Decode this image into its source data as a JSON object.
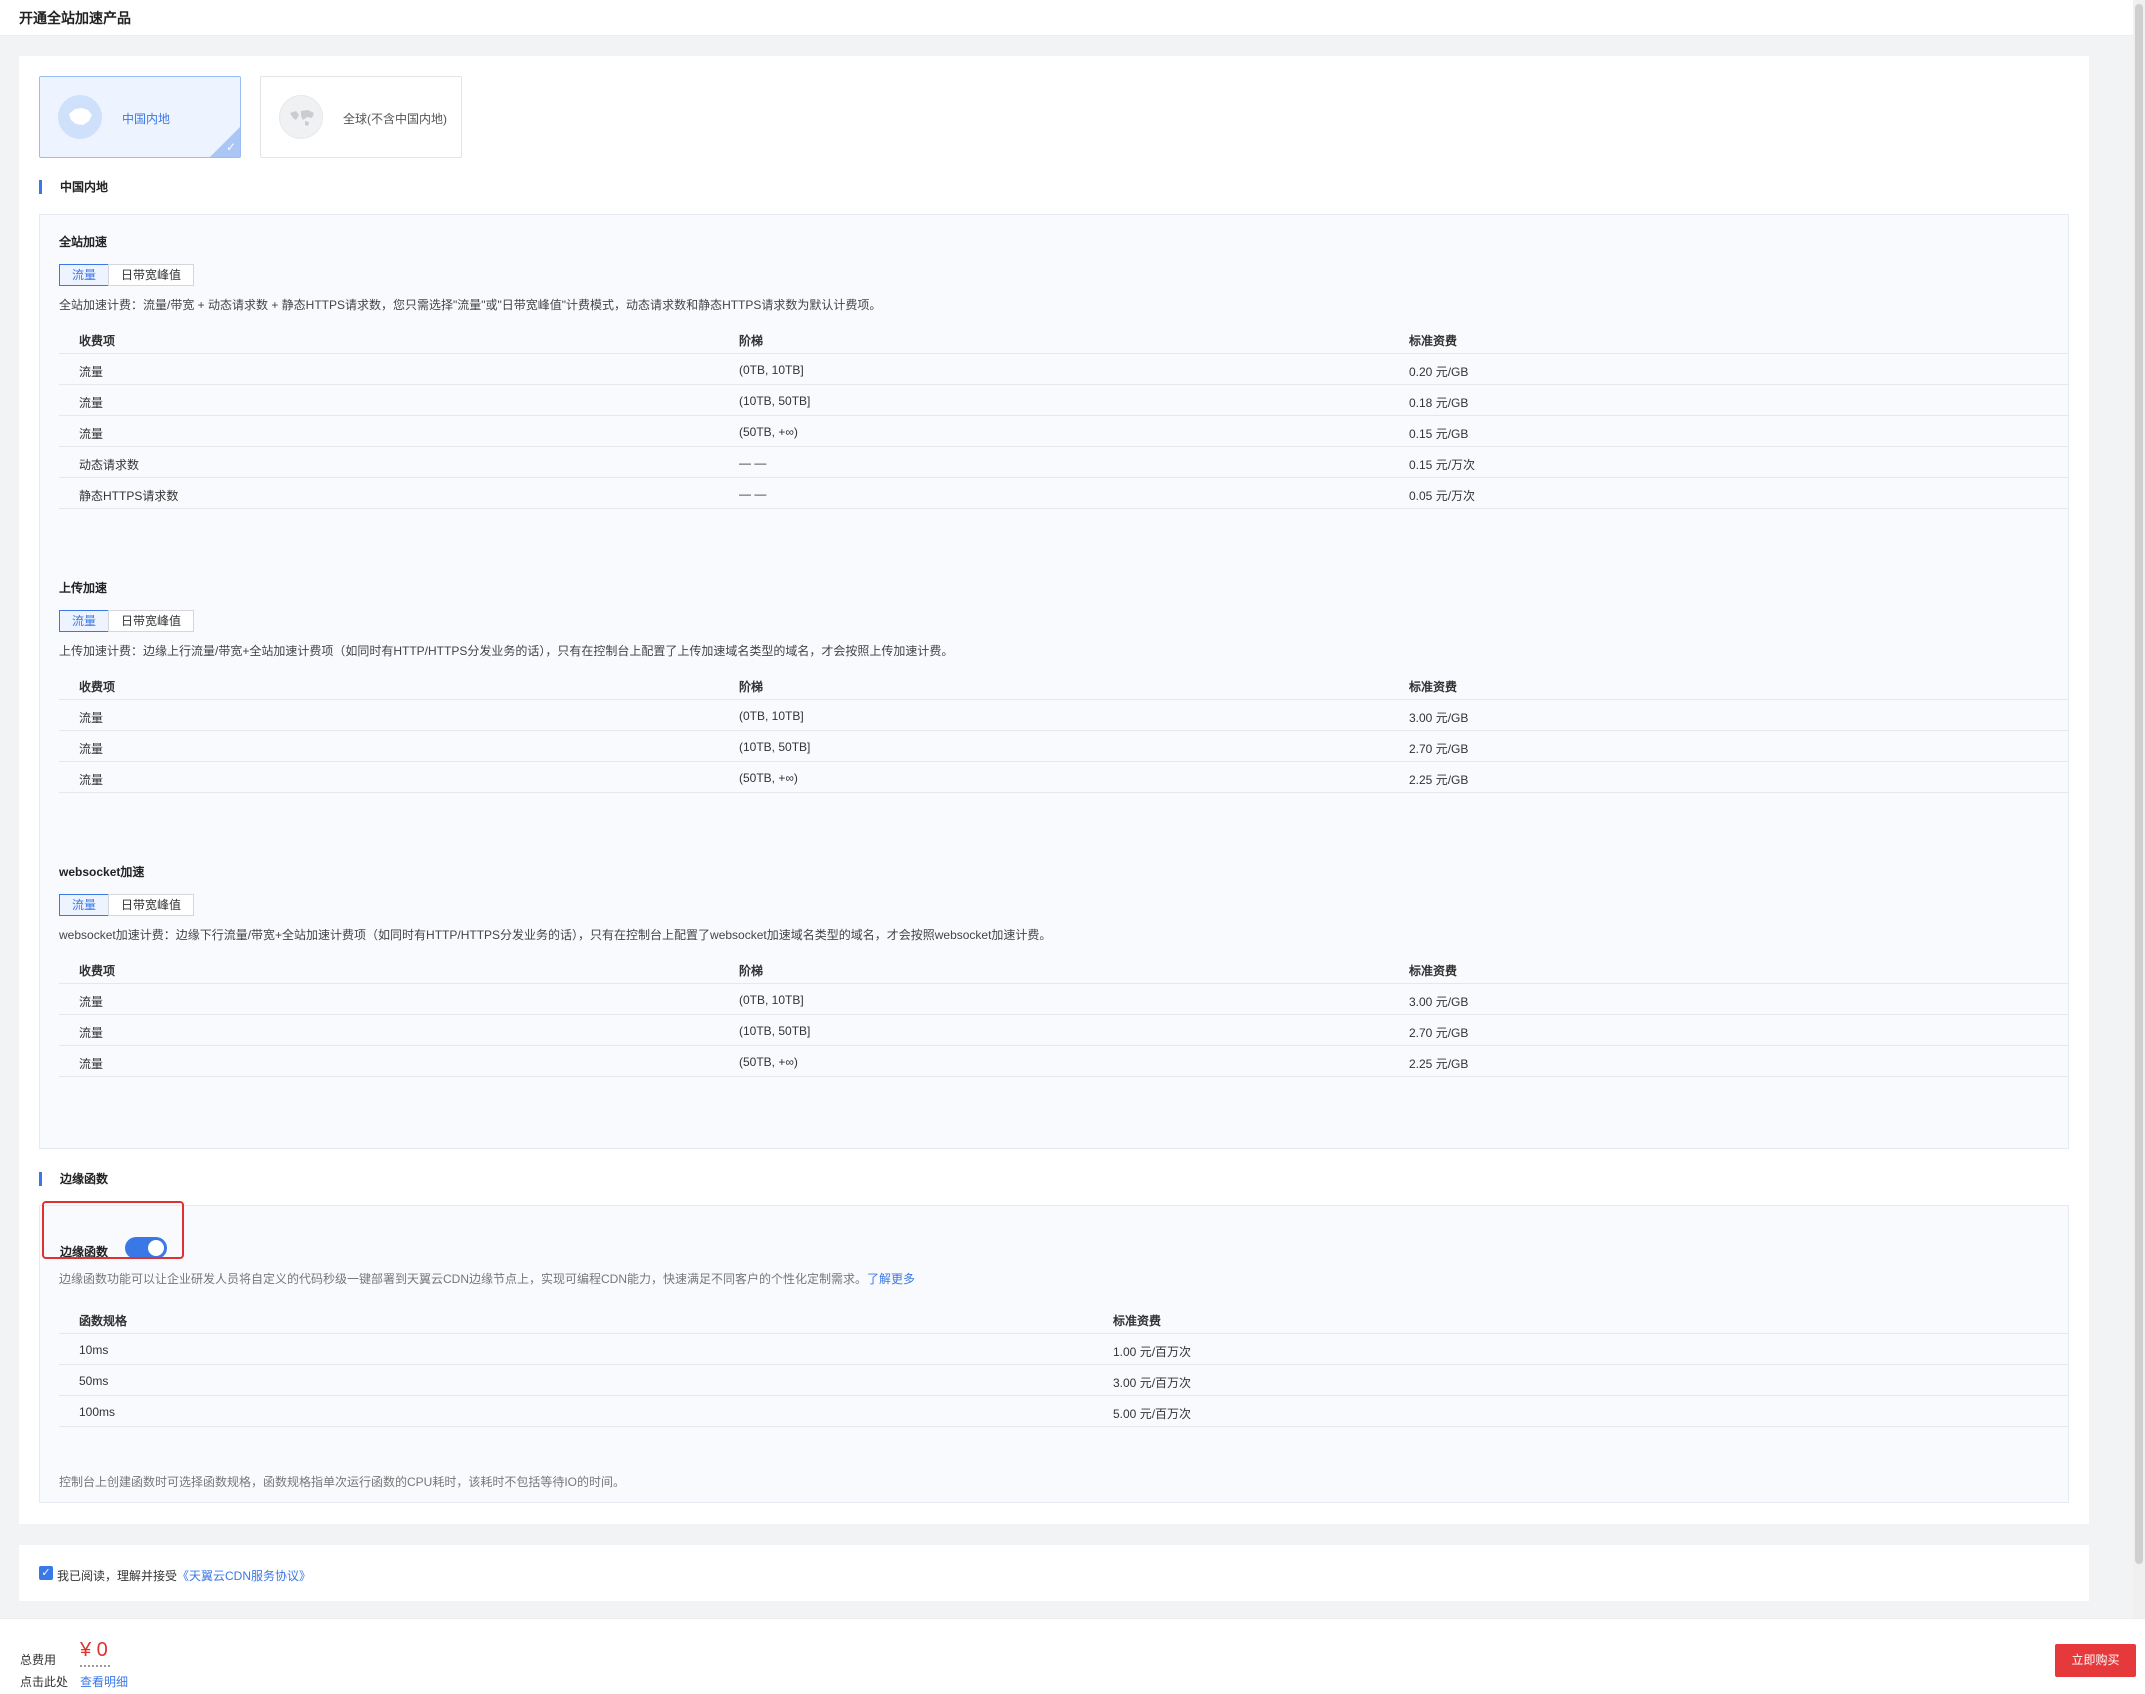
{
  "page": {
    "title": "开通全站加速产品"
  },
  "regions": [
    {
      "label": "中国内地",
      "selected": true
    },
    {
      "label": "全球(不含中国内地)",
      "selected": false
    }
  ],
  "section_mainland": {
    "title": "中国内地"
  },
  "columns": {
    "item": "收费项",
    "tier": "阶梯",
    "price": "标准资费"
  },
  "full_accel": {
    "title": "全站加速",
    "tabs": [
      "流量",
      "日带宽峰值"
    ],
    "desc": "全站加速计费：流量/带宽 + 动态请求数 + 静态HTTPS请求数，您只需选择\"流量\"或\"日带宽峰值\"计费模式，动态请求数和静态HTTPS请求数为默认计费项。",
    "rows": [
      {
        "item": "流量",
        "tier": "(0TB, 10TB]",
        "price": "0.20 元/GB"
      },
      {
        "item": "流量",
        "tier": "(10TB, 50TB]",
        "price": "0.18 元/GB"
      },
      {
        "item": "流量",
        "tier": "(50TB, +∞)",
        "price": "0.15 元/GB"
      },
      {
        "item": "动态请求数",
        "tier": "— —",
        "price": "0.15 元/万次"
      },
      {
        "item": "静态HTTPS请求数",
        "tier": "— —",
        "price": "0.05 元/万次"
      }
    ]
  },
  "upload_accel": {
    "title": "上传加速",
    "tabs": [
      "流量",
      "日带宽峰值"
    ],
    "desc": "上传加速计费：边缘上行流量/带宽+全站加速计费项（如同时有HTTP/HTTPS分发业务的话），只有在控制台上配置了上传加速域名类型的域名，才会按照上传加速计费。",
    "rows": [
      {
        "item": "流量",
        "tier": "(0TB, 10TB]",
        "price": "3.00 元/GB"
      },
      {
        "item": "流量",
        "tier": "(10TB, 50TB]",
        "price": "2.70 元/GB"
      },
      {
        "item": "流量",
        "tier": "(50TB, +∞)",
        "price": "2.25 元/GB"
      }
    ]
  },
  "ws_accel": {
    "title": "websocket加速",
    "tabs": [
      "流量",
      "日带宽峰值"
    ],
    "desc": "websocket加速计费：边缘下行流量/带宽+全站加速计费项（如同时有HTTP/HTTPS分发业务的话），只有在控制台上配置了websocket加速域名类型的域名，才会按照websocket加速计费。",
    "rows": [
      {
        "item": "流量",
        "tier": "(0TB, 10TB]",
        "price": "3.00 元/GB"
      },
      {
        "item": "流量",
        "tier": "(10TB, 50TB]",
        "price": "2.70 元/GB"
      },
      {
        "item": "流量",
        "tier": "(50TB, +∞)",
        "price": "2.25 元/GB"
      }
    ]
  },
  "edge": {
    "section_title": "边缘函数",
    "toggle_label": "边缘函数",
    "toggle_on": true,
    "desc": "边缘函数功能可以让企业研发人员将自定义的代码秒级一键部署到天翼云CDN边缘节点上，实现可编程CDN能力，快速满足不同客户的个性化定制需求。",
    "learn_more": "了解更多",
    "col_spec": "函数规格",
    "col_price": "标准资费",
    "rows": [
      {
        "spec": "10ms",
        "price": "1.00 元/百万次"
      },
      {
        "spec": "50ms",
        "price": "3.00 元/百万次"
      },
      {
        "spec": "100ms",
        "price": "5.00 元/百万次"
      }
    ],
    "note": "控制台上创建函数时可选择函数规格，函数规格指单次运行函数的CPU耗时，该耗时不包括等待IO的时间。"
  },
  "agreement": {
    "text": "我已阅读，理解并接受",
    "link": "《天翼云CDN服务协议》",
    "checked": true
  },
  "footer": {
    "total_label": "总费用",
    "price": "¥ 0",
    "click_label": "点击此处",
    "detail_link": "查看明细",
    "buy_button": "立即购买"
  },
  "colors": {
    "accent": "#3b78e7",
    "danger": "#e5393c"
  }
}
